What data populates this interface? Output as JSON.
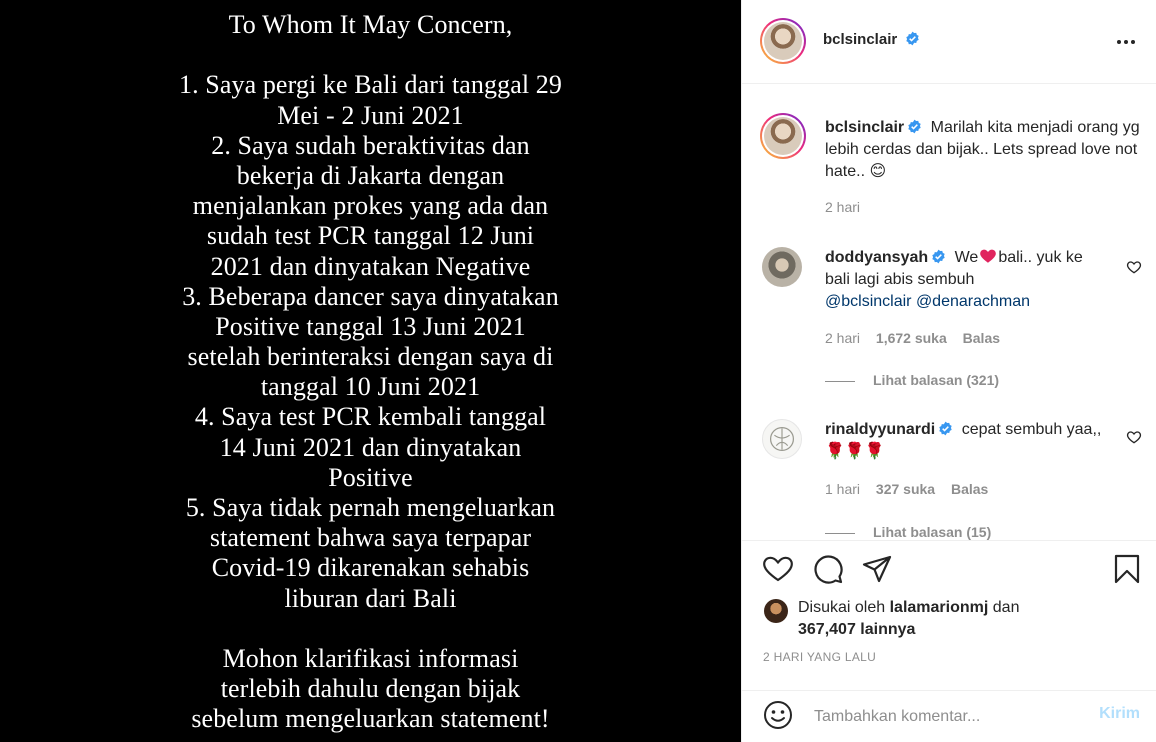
{
  "post_image": {
    "lines": [
      "To Whom It May Concern,",
      "",
      "1. Saya pergi ke Bali dari tanggal 29",
      "Mei - 2 Juni 2021",
      "2. Saya sudah beraktivitas dan",
      "bekerja di Jakarta dengan",
      "menjalankan prokes yang ada dan",
      "sudah test PCR tanggal 12 Juni",
      "2021 dan dinyatakan Negative",
      "3. Beberapa dancer saya dinyatakan",
      "Positive tanggal 13 Juni 2021",
      "setelah berinteraksi dengan saya di",
      "tanggal 10 Juni 2021",
      "4. Saya test PCR kembali tanggal",
      "14 Juni 2021 dan dinyatakan",
      "Positive",
      "5. Saya tidak pernah mengeluarkan",
      "statement bahwa saya terpapar",
      "Covid-19 dikarenakan sehabis",
      "liburan dari Bali",
      "",
      "Mohon klarifikasi informasi",
      "terlebih dahulu dengan bijak",
      "sebelum mengeluarkan statement!"
    ]
  },
  "header": {
    "username": "bclsinclair",
    "more_icon": "more-horizontal-icon"
  },
  "caption": {
    "username": "bclsinclair",
    "text": "Marilah kita menjadi orang yg lebih cerdas dan bijak.. Lets spread love not hate.. 😊",
    "time": "2 hari"
  },
  "comments": [
    {
      "username": "doddyansyah",
      "text_before": "We",
      "text_after": "bali.. yuk ke bali lagi abis sembuh",
      "mention1": "@bclsinclair",
      "mention2": "@denarachman",
      "time": "2 hari",
      "likes": "1,672 suka",
      "reply": "Balas",
      "view_replies": "Lihat balasan (321)"
    },
    {
      "username": "rinaldyyunardi",
      "text": "cepat sembuh yaa,, 🌹🌹🌹",
      "time": "1 hari",
      "likes": "327 suka",
      "reply": "Balas",
      "view_replies": "Lihat balasan (15)"
    }
  ],
  "likes": {
    "prefix": "Disukai oleh",
    "user": "lalamarionmj",
    "conj": "dan",
    "count": "367,407 lainnya"
  },
  "post_date": "2 HARI YANG LALU",
  "add_comment": {
    "placeholder": "Tambahkan komentar...",
    "post_label": "Kirim"
  },
  "colors": {
    "link": "#00376b",
    "muted": "#8e8e8e",
    "verified": "#3897f0",
    "post_disabled": "#b2dffc"
  }
}
